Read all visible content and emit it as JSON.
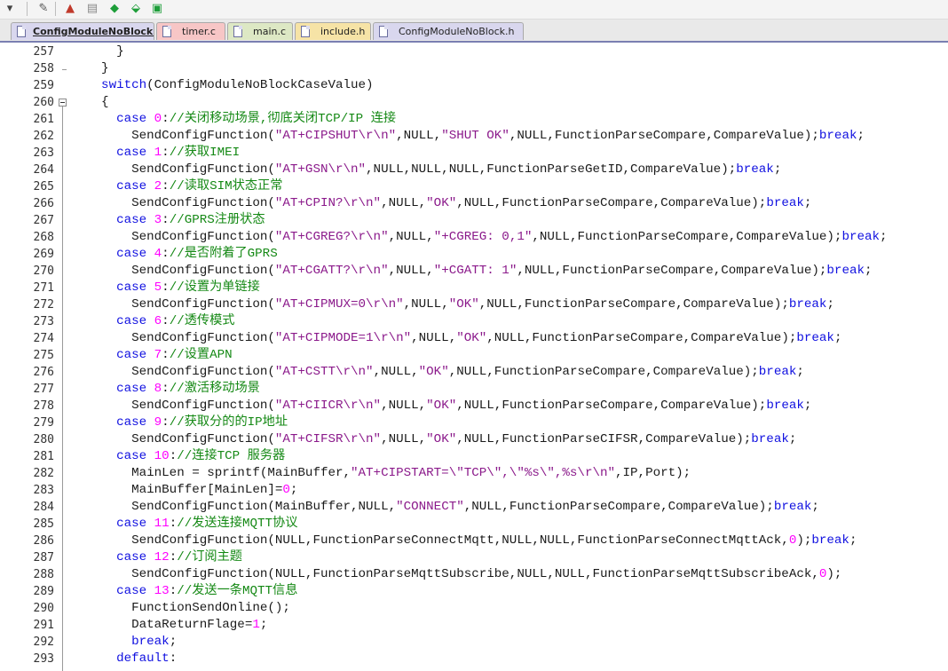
{
  "toolbar": {
    "buttons": [
      {
        "icon": "dropdown-arrow-icon",
        "glyph": "▾"
      },
      {
        "icon": "wand-icon",
        "glyph": "✎"
      },
      {
        "icon": "build-red-icon",
        "glyph": "▲"
      },
      {
        "icon": "stack-gray-icon",
        "glyph": "▤"
      },
      {
        "icon": "diamond-green-icon",
        "glyph": "◆"
      },
      {
        "icon": "download-diamond-icon",
        "glyph": "⬙"
      },
      {
        "icon": "batch-build-icon",
        "glyph": "▣"
      }
    ]
  },
  "tabs": [
    {
      "label": "ConfigModuleNoBlock.c",
      "active": true,
      "color": "#d9d7ee"
    },
    {
      "label": "timer.c",
      "active": false,
      "color": "#f7c6c6"
    },
    {
      "label": "main.c",
      "active": false,
      "color": "#dde8c4"
    },
    {
      "label": "include.h",
      "active": false,
      "color": "#f6e3a6"
    },
    {
      "label": "ConfigModuleNoBlock.h",
      "active": false,
      "color": "#d9d7ee"
    }
  ],
  "colors": {
    "keyword": "#1010e0",
    "string": "#8b1a8b",
    "number": "#ff00ff",
    "comment": "#158915"
  },
  "lines": [
    {
      "n": "257",
      "t": [
        [
          "p",
          "      }"
        ]
      ]
    },
    {
      "n": "258",
      "t": [
        [
          "p",
          "    }"
        ]
      ],
      "foldEnd": true
    },
    {
      "n": "259",
      "t": [
        [
          "k",
          "    switch"
        ],
        [
          "p",
          "(ConfigModuleNoBlockCaseValue)"
        ]
      ]
    },
    {
      "n": "260",
      "t": [
        [
          "p",
          "    {"
        ]
      ],
      "fold": true
    },
    {
      "n": "261",
      "t": [
        [
          "k",
          "      case "
        ],
        [
          "n",
          "0"
        ],
        [
          "p",
          ":"
        ],
        [
          "c",
          "//关闭移动场景,彻底关闭TCP/IP 连接"
        ]
      ]
    },
    {
      "n": "262",
      "t": [
        [
          "p",
          "        SendConfigFunction("
        ],
        [
          "s",
          "\"AT+CIPSHUT\\r\\n\""
        ],
        [
          "p",
          ",NULL,"
        ],
        [
          "s",
          "\"SHUT OK\""
        ],
        [
          "p",
          ",NULL,FunctionParseCompare,CompareValue);"
        ],
        [
          "k",
          "break"
        ],
        [
          "p",
          ";"
        ]
      ]
    },
    {
      "n": "263",
      "t": [
        [
          "k",
          "      case "
        ],
        [
          "n",
          "1"
        ],
        [
          "p",
          ":"
        ],
        [
          "c",
          "//获取IMEI"
        ]
      ]
    },
    {
      "n": "264",
      "t": [
        [
          "p",
          "        SendConfigFunction("
        ],
        [
          "s",
          "\"AT+GSN\\r\\n\""
        ],
        [
          "p",
          ",NULL,NULL,NULL,FunctionParseGetID,CompareValue);"
        ],
        [
          "k",
          "break"
        ],
        [
          "p",
          ";"
        ]
      ]
    },
    {
      "n": "265",
      "t": [
        [
          "k",
          "      case "
        ],
        [
          "n",
          "2"
        ],
        [
          "p",
          ":"
        ],
        [
          "c",
          "//读取SIM状态正常"
        ]
      ]
    },
    {
      "n": "266",
      "t": [
        [
          "p",
          "        SendConfigFunction("
        ],
        [
          "s",
          "\"AT+CPIN?\\r\\n\""
        ],
        [
          "p",
          ",NULL,"
        ],
        [
          "s",
          "\"OK\""
        ],
        [
          "p",
          ",NULL,FunctionParseCompare,CompareValue);"
        ],
        [
          "k",
          "break"
        ],
        [
          "p",
          ";"
        ]
      ]
    },
    {
      "n": "267",
      "t": [
        [
          "k",
          "      case "
        ],
        [
          "n",
          "3"
        ],
        [
          "p",
          ":"
        ],
        [
          "c",
          "//GPRS注册状态"
        ]
      ]
    },
    {
      "n": "268",
      "t": [
        [
          "p",
          "        SendConfigFunction("
        ],
        [
          "s",
          "\"AT+CGREG?\\r\\n\""
        ],
        [
          "p",
          ",NULL,"
        ],
        [
          "s",
          "\"+CGREG: 0,1\""
        ],
        [
          "p",
          ",NULL,FunctionParseCompare,CompareValue);"
        ],
        [
          "k",
          "break"
        ],
        [
          "p",
          ";"
        ]
      ]
    },
    {
      "n": "269",
      "t": [
        [
          "k",
          "      case "
        ],
        [
          "n",
          "4"
        ],
        [
          "p",
          ":"
        ],
        [
          "c",
          "//是否附着了GPRS"
        ]
      ]
    },
    {
      "n": "270",
      "t": [
        [
          "p",
          "        SendConfigFunction("
        ],
        [
          "s",
          "\"AT+CGATT?\\r\\n\""
        ],
        [
          "p",
          ",NULL,"
        ],
        [
          "s",
          "\"+CGATT: 1\""
        ],
        [
          "p",
          ",NULL,FunctionParseCompare,CompareValue);"
        ],
        [
          "k",
          "break"
        ],
        [
          "p",
          ";"
        ]
      ]
    },
    {
      "n": "271",
      "t": [
        [
          "k",
          "      case "
        ],
        [
          "n",
          "5"
        ],
        [
          "p",
          ":"
        ],
        [
          "c",
          "//设置为单链接"
        ]
      ]
    },
    {
      "n": "272",
      "t": [
        [
          "p",
          "        SendConfigFunction("
        ],
        [
          "s",
          "\"AT+CIPMUX=0\\r\\n\""
        ],
        [
          "p",
          ",NULL,"
        ],
        [
          "s",
          "\"OK\""
        ],
        [
          "p",
          ",NULL,FunctionParseCompare,CompareValue);"
        ],
        [
          "k",
          "break"
        ],
        [
          "p",
          ";"
        ]
      ]
    },
    {
      "n": "273",
      "t": [
        [
          "k",
          "      case "
        ],
        [
          "n",
          "6"
        ],
        [
          "p",
          ":"
        ],
        [
          "c",
          "//透传模式"
        ]
      ]
    },
    {
      "n": "274",
      "t": [
        [
          "p",
          "        SendConfigFunction("
        ],
        [
          "s",
          "\"AT+CIPMODE=1\\r\\n\""
        ],
        [
          "p",
          ",NULL,"
        ],
        [
          "s",
          "\"OK\""
        ],
        [
          "p",
          ",NULL,FunctionParseCompare,CompareValue);"
        ],
        [
          "k",
          "break"
        ],
        [
          "p",
          ";"
        ]
      ]
    },
    {
      "n": "275",
      "t": [
        [
          "k",
          "      case "
        ],
        [
          "n",
          "7"
        ],
        [
          "p",
          ":"
        ],
        [
          "c",
          "//设置APN"
        ]
      ]
    },
    {
      "n": "276",
      "t": [
        [
          "p",
          "        SendConfigFunction("
        ],
        [
          "s",
          "\"AT+CSTT\\r\\n\""
        ],
        [
          "p",
          ",NULL,"
        ],
        [
          "s",
          "\"OK\""
        ],
        [
          "p",
          ",NULL,FunctionParseCompare,CompareValue);"
        ],
        [
          "k",
          "break"
        ],
        [
          "p",
          ";"
        ]
      ]
    },
    {
      "n": "277",
      "t": [
        [
          "k",
          "      case "
        ],
        [
          "n",
          "8"
        ],
        [
          "p",
          ":"
        ],
        [
          "c",
          "//激活移动场景"
        ]
      ]
    },
    {
      "n": "278",
      "t": [
        [
          "p",
          "        SendConfigFunction("
        ],
        [
          "s",
          "\"AT+CIICR\\r\\n\""
        ],
        [
          "p",
          ",NULL,"
        ],
        [
          "s",
          "\"OK\""
        ],
        [
          "p",
          ",NULL,FunctionParseCompare,CompareValue);"
        ],
        [
          "k",
          "break"
        ],
        [
          "p",
          ";"
        ]
      ]
    },
    {
      "n": "279",
      "t": [
        [
          "k",
          "      case "
        ],
        [
          "n",
          "9"
        ],
        [
          "p",
          ":"
        ],
        [
          "c",
          "//获取分的的IP地址"
        ]
      ]
    },
    {
      "n": "280",
      "t": [
        [
          "p",
          "        SendConfigFunction("
        ],
        [
          "s",
          "\"AT+CIFSR\\r\\n\""
        ],
        [
          "p",
          ",NULL,"
        ],
        [
          "s",
          "\"OK\""
        ],
        [
          "p",
          ",NULL,FunctionParseCIFSR,CompareValue);"
        ],
        [
          "k",
          "break"
        ],
        [
          "p",
          ";"
        ]
      ]
    },
    {
      "n": "281",
      "t": [
        [
          "k",
          "      case "
        ],
        [
          "n",
          "10"
        ],
        [
          "p",
          ":"
        ],
        [
          "c",
          "//连接TCP 服务器"
        ]
      ]
    },
    {
      "n": "282",
      "t": [
        [
          "p",
          "        MainLen = sprintf(MainBuffer,"
        ],
        [
          "s",
          "\"AT+CIPSTART=\\\"TCP\\\",\\\"%s\\\",%s\\r\\n\""
        ],
        [
          "p",
          ",IP,Port);"
        ]
      ]
    },
    {
      "n": "283",
      "t": [
        [
          "p",
          "        MainBuffer[MainLen]="
        ],
        [
          "n",
          "0"
        ],
        [
          "p",
          ";"
        ]
      ]
    },
    {
      "n": "284",
      "t": [
        [
          "p",
          "        SendConfigFunction(MainBuffer,NULL,"
        ],
        [
          "s",
          "\"CONNECT\""
        ],
        [
          "p",
          ",NULL,FunctionParseCompare,CompareValue);"
        ],
        [
          "k",
          "break"
        ],
        [
          "p",
          ";"
        ]
      ]
    },
    {
      "n": "285",
      "t": [
        [
          "k",
          "      case "
        ],
        [
          "n",
          "11"
        ],
        [
          "p",
          ":"
        ],
        [
          "c",
          "//发送连接MQTT协议"
        ]
      ]
    },
    {
      "n": "286",
      "t": [
        [
          "p",
          "        SendConfigFunction(NULL,FunctionParseConnectMqtt,NULL,NULL,FunctionParseConnectMqttAck,"
        ],
        [
          "n",
          "0"
        ],
        [
          "p",
          ");"
        ],
        [
          "k",
          "break"
        ],
        [
          "p",
          ";"
        ]
      ]
    },
    {
      "n": "287",
      "t": [
        [
          "k",
          "      case "
        ],
        [
          "n",
          "12"
        ],
        [
          "p",
          ":"
        ],
        [
          "c",
          "//订阅主题"
        ]
      ]
    },
    {
      "n": "288",
      "t": [
        [
          "p",
          "        SendConfigFunction(NULL,FunctionParseMqttSubscribe,NULL,NULL,FunctionParseMqttSubscribeAck,"
        ],
        [
          "n",
          "0"
        ],
        [
          "p",
          ");"
        ]
      ]
    },
    {
      "n": "289",
      "t": [
        [
          "k",
          "      case "
        ],
        [
          "n",
          "13"
        ],
        [
          "p",
          ":"
        ],
        [
          "c",
          "//发送一条MQTT信息"
        ]
      ]
    },
    {
      "n": "290",
      "t": [
        [
          "p",
          "        FunctionSendOnline();"
        ]
      ]
    },
    {
      "n": "291",
      "t": [
        [
          "p",
          "        DataReturnFlage="
        ],
        [
          "n",
          "1"
        ],
        [
          "p",
          ";"
        ]
      ]
    },
    {
      "n": "292",
      "t": [
        [
          "k",
          "        break"
        ],
        [
          "p",
          ";"
        ]
      ]
    },
    {
      "n": "293",
      "t": [
        [
          "k",
          "      default"
        ],
        [
          "p",
          ":"
        ]
      ]
    }
  ]
}
